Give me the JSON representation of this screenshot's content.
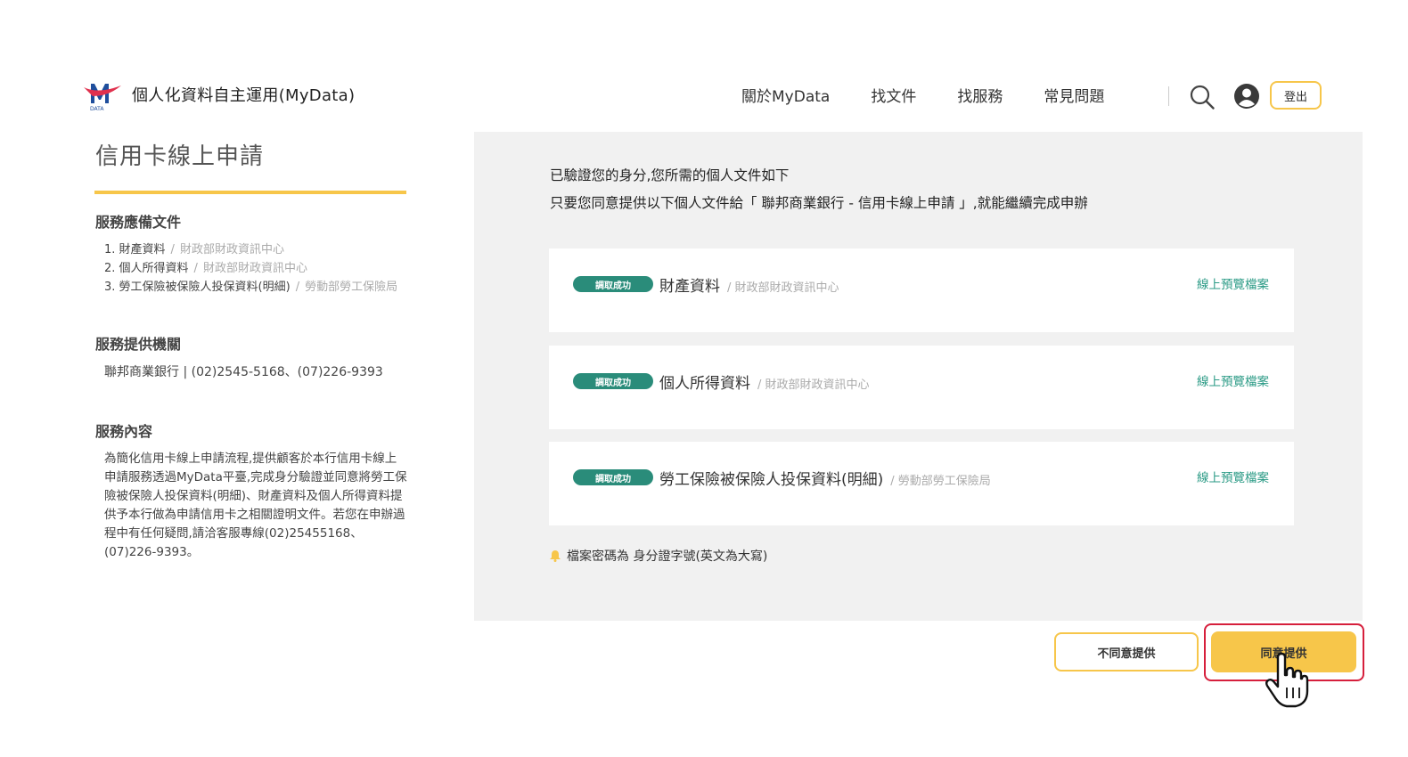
{
  "header": {
    "site_title": "個人化資料自主運用(MyData)",
    "logo_text": "DATA",
    "nav": [
      "關於MyData",
      "找文件",
      "找服務",
      "常見問題"
    ],
    "logout_label": "登出"
  },
  "left": {
    "page_title": "信用卡線上申請",
    "docs_title": "服務應備文件",
    "docs": [
      {
        "name": "1. 財產資料",
        "source": "財政部財政資訊中心"
      },
      {
        "name": "2. 個人所得資料",
        "source": "財政部財政資訊中心"
      },
      {
        "name": "3. 勞工保險被保險人投保資料(明細)",
        "source": "勞動部勞工保險局"
      }
    ],
    "provider_title": "服務提供機關",
    "provider_text": "聯邦商業銀行 | (02)2545-5168、(07)226-9393",
    "content_title": "服務內容",
    "content_text": "為簡化信用卡線上申請流程,提供顧客於本行信用卡線上申請服務透過MyData平臺,完成身分驗證並同意將勞工保險被保險人投保資料(明細)、財產資料及個人所得資料提供予本行做為申請信用卡之相關證明文件。若您在申辦過程中有任何疑問,請洽客服專線(02)25455168、(07)226-9393。"
  },
  "main": {
    "intro_line1": "已驗證您的身分,您所需的個人文件如下",
    "intro_line2": "只要您同意提供以下個人文件給「 聯邦商業銀行 - 信用卡線上申請 」,就能繼續完成申辦",
    "cards": [
      {
        "badge": "調取成功",
        "name": "財產資料",
        "source": "/ 財政部財政資訊中心",
        "preview": "線上預覽檔案"
      },
      {
        "badge": "調取成功",
        "name": "個人所得資料",
        "source": "/ 財政部財政資訊中心",
        "preview": "線上預覽檔案"
      },
      {
        "badge": "調取成功",
        "name": "勞工保險被保險人投保資料(明細)",
        "source": "/ 勞動部勞工保險局",
        "preview": "線上預覽檔案"
      }
    ],
    "note": "檔案密碼為 身分證字號(英文為大寫)"
  },
  "actions": {
    "disagree_label": "不同意提供",
    "agree_label": "同意提供"
  },
  "colors": {
    "accent": "#f7c64a",
    "badge": "#2a8c7a",
    "link": "#2a9a85",
    "highlight": "#d61f3c"
  }
}
